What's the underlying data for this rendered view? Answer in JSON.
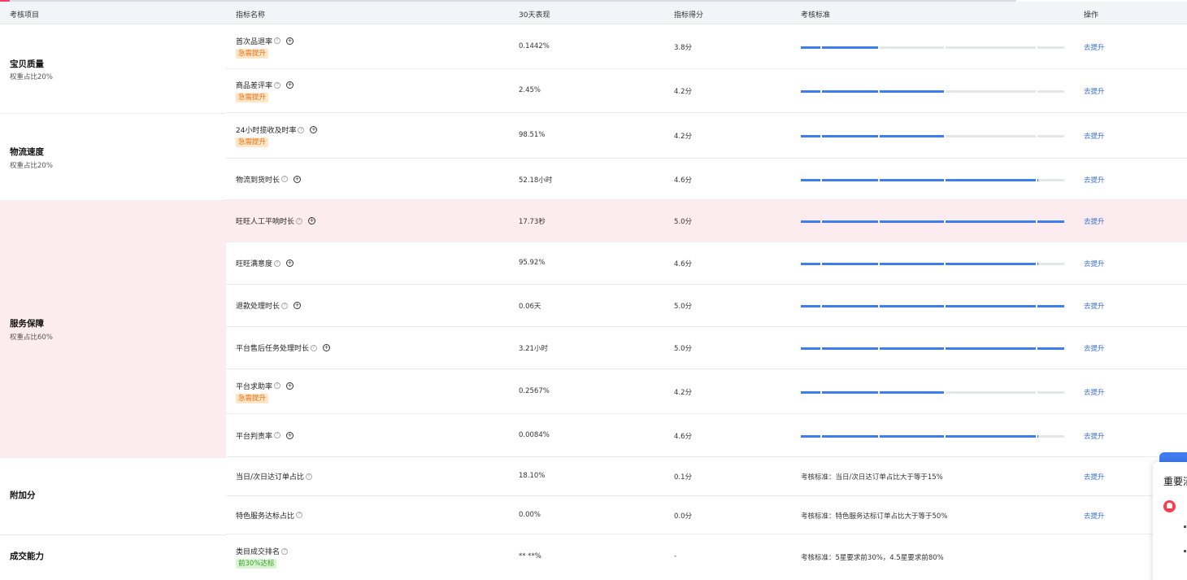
{
  "header": {
    "col_category": "考核项目",
    "col_indicator": "指标名称",
    "col_perf": "30天表现",
    "col_score": "指标得分",
    "col_standard": "考核标准",
    "col_action": "操作"
  },
  "categories": {
    "quality": {
      "title": "宝贝质量",
      "weight": "权重占比20%"
    },
    "logistics": {
      "title": "物流速度",
      "weight": "权重占比20%"
    },
    "service": {
      "title": "服务保障",
      "weight": "权重占比60%"
    },
    "bonus": {
      "title": "附加分"
    },
    "deal": {
      "title": "成交能力"
    }
  },
  "rows": [
    {
      "name": "首次品退率",
      "badge": "急需提升",
      "perf": "0.1442%",
      "score": "3.8分",
      "progress": 0.3,
      "action": "去提升"
    },
    {
      "name": "商品差评率",
      "badge": "急需提升",
      "perf": "2.45%",
      "score": "4.2分",
      "progress": 0.55,
      "action": "去提升"
    },
    {
      "name": "24小时揽收及时率",
      "badge": "急需提升",
      "perf": "98.51%",
      "score": "4.2分",
      "progress": 0.55,
      "action": "去提升"
    },
    {
      "name": "物流到货时长",
      "perf": "52.18小时",
      "score": "4.6分",
      "progress": 0.9,
      "action": "去提升"
    },
    {
      "name": "旺旺人工平响时长",
      "perf": "17.73秒",
      "score": "5.0分",
      "progress": 1.0,
      "action": "去提升"
    },
    {
      "name": "旺旺满意度",
      "perf": "95.92%",
      "score": "4.6分",
      "progress": 0.9,
      "action": "去提升"
    },
    {
      "name": "退款处理时长",
      "perf": "0.06天",
      "score": "5.0分",
      "progress": 1.0,
      "action": "去提升"
    },
    {
      "name": "平台售后任务处理时长",
      "perf": "3.21小时",
      "score": "5.0分",
      "progress": 1.0,
      "action": "去提升"
    },
    {
      "name": "平台求助率",
      "badge": "急需提升",
      "perf": "0.2567%",
      "score": "4.2分",
      "progress": 0.55,
      "action": "去提升"
    },
    {
      "name": "平台判责率",
      "perf": "0.0084%",
      "score": "4.6分",
      "progress": 0.9,
      "action": "去提升"
    },
    {
      "name": "当日/次日达订单占比",
      "perf": "18.10%",
      "score": "0.1分",
      "standard": "考核标准：当日/次日达订单占比大于等于15%",
      "action": "去提升"
    },
    {
      "name": "特色服务达标占比",
      "perf": "0.00%",
      "score": "0.0分",
      "standard": "考核标准：特色服务达标订单占比大于等于50%",
      "action": "去提升"
    },
    {
      "name": "类目成交排名",
      "badge_ok": "前30%达标",
      "perf": "** **%",
      "score": "-",
      "standard": "考核标准：5星要求前30%，4.5星要求前80%"
    }
  ],
  "popup": {
    "title": "重要消"
  },
  "colors": {
    "accent": "#3f7cf0",
    "highlight_bg": "#fdecef",
    "warn_badge": "#ffe6c7",
    "ok_badge": "#d8f5d2",
    "link": "#3a6fd8"
  },
  "icons": {
    "help": "question-circle-icon",
    "expand": "plus-circle-icon",
    "bell": "bell-icon"
  }
}
